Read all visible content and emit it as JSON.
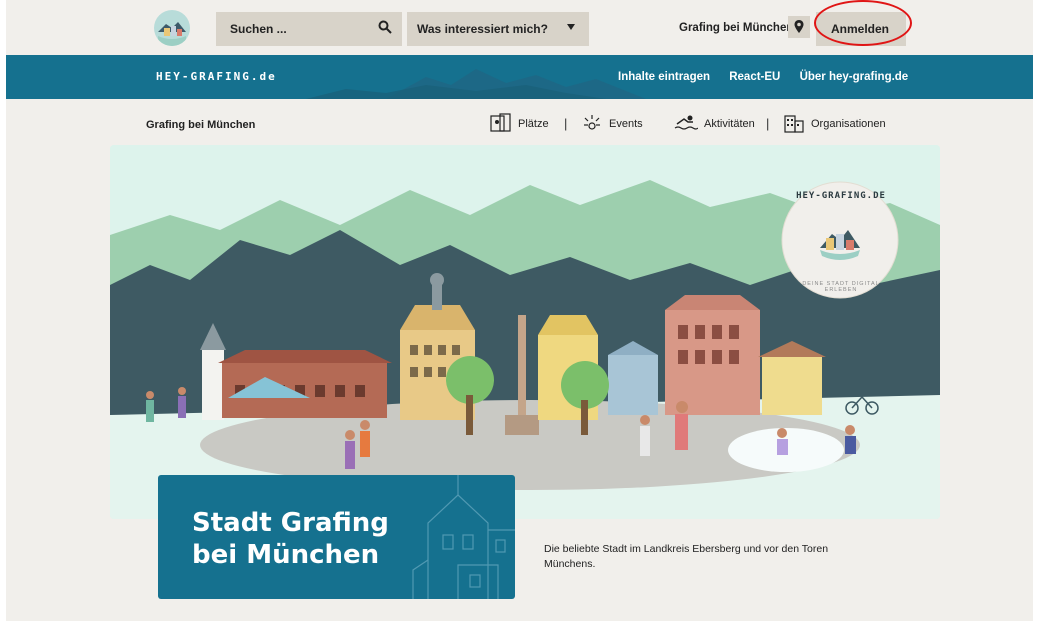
{
  "header": {
    "search_placeholder": "Suchen ...",
    "interest_label": "Was interessiert mich?",
    "city": "Grafing bei München",
    "login_label": "Anmelden"
  },
  "bluebar": {
    "brand": "HEY-GRAFING.de",
    "links": [
      "Inhalte eintragen",
      "React-EU",
      "Über hey-grafing.de"
    ]
  },
  "categories": {
    "city": "Grafing bei München",
    "items": [
      "Plätze",
      "Events",
      "Aktivitäten",
      "Organisationen"
    ]
  },
  "hero": {
    "badge_text": "HEY-GRAFING.DE",
    "badge_sub": "DEINE STADT DIGITAL ERLEBEN"
  },
  "intro": {
    "title_line1": "Stadt Grafing",
    "title_line2": "bei München",
    "description": "Die beliebte Stadt im Landkreis Ebersberg und vor den Toren Münchens."
  },
  "colors": {
    "primary": "#15718f",
    "control_bg": "#d8d3c9",
    "page_bg": "#f1efeb",
    "highlight_ring": "#e01515"
  }
}
